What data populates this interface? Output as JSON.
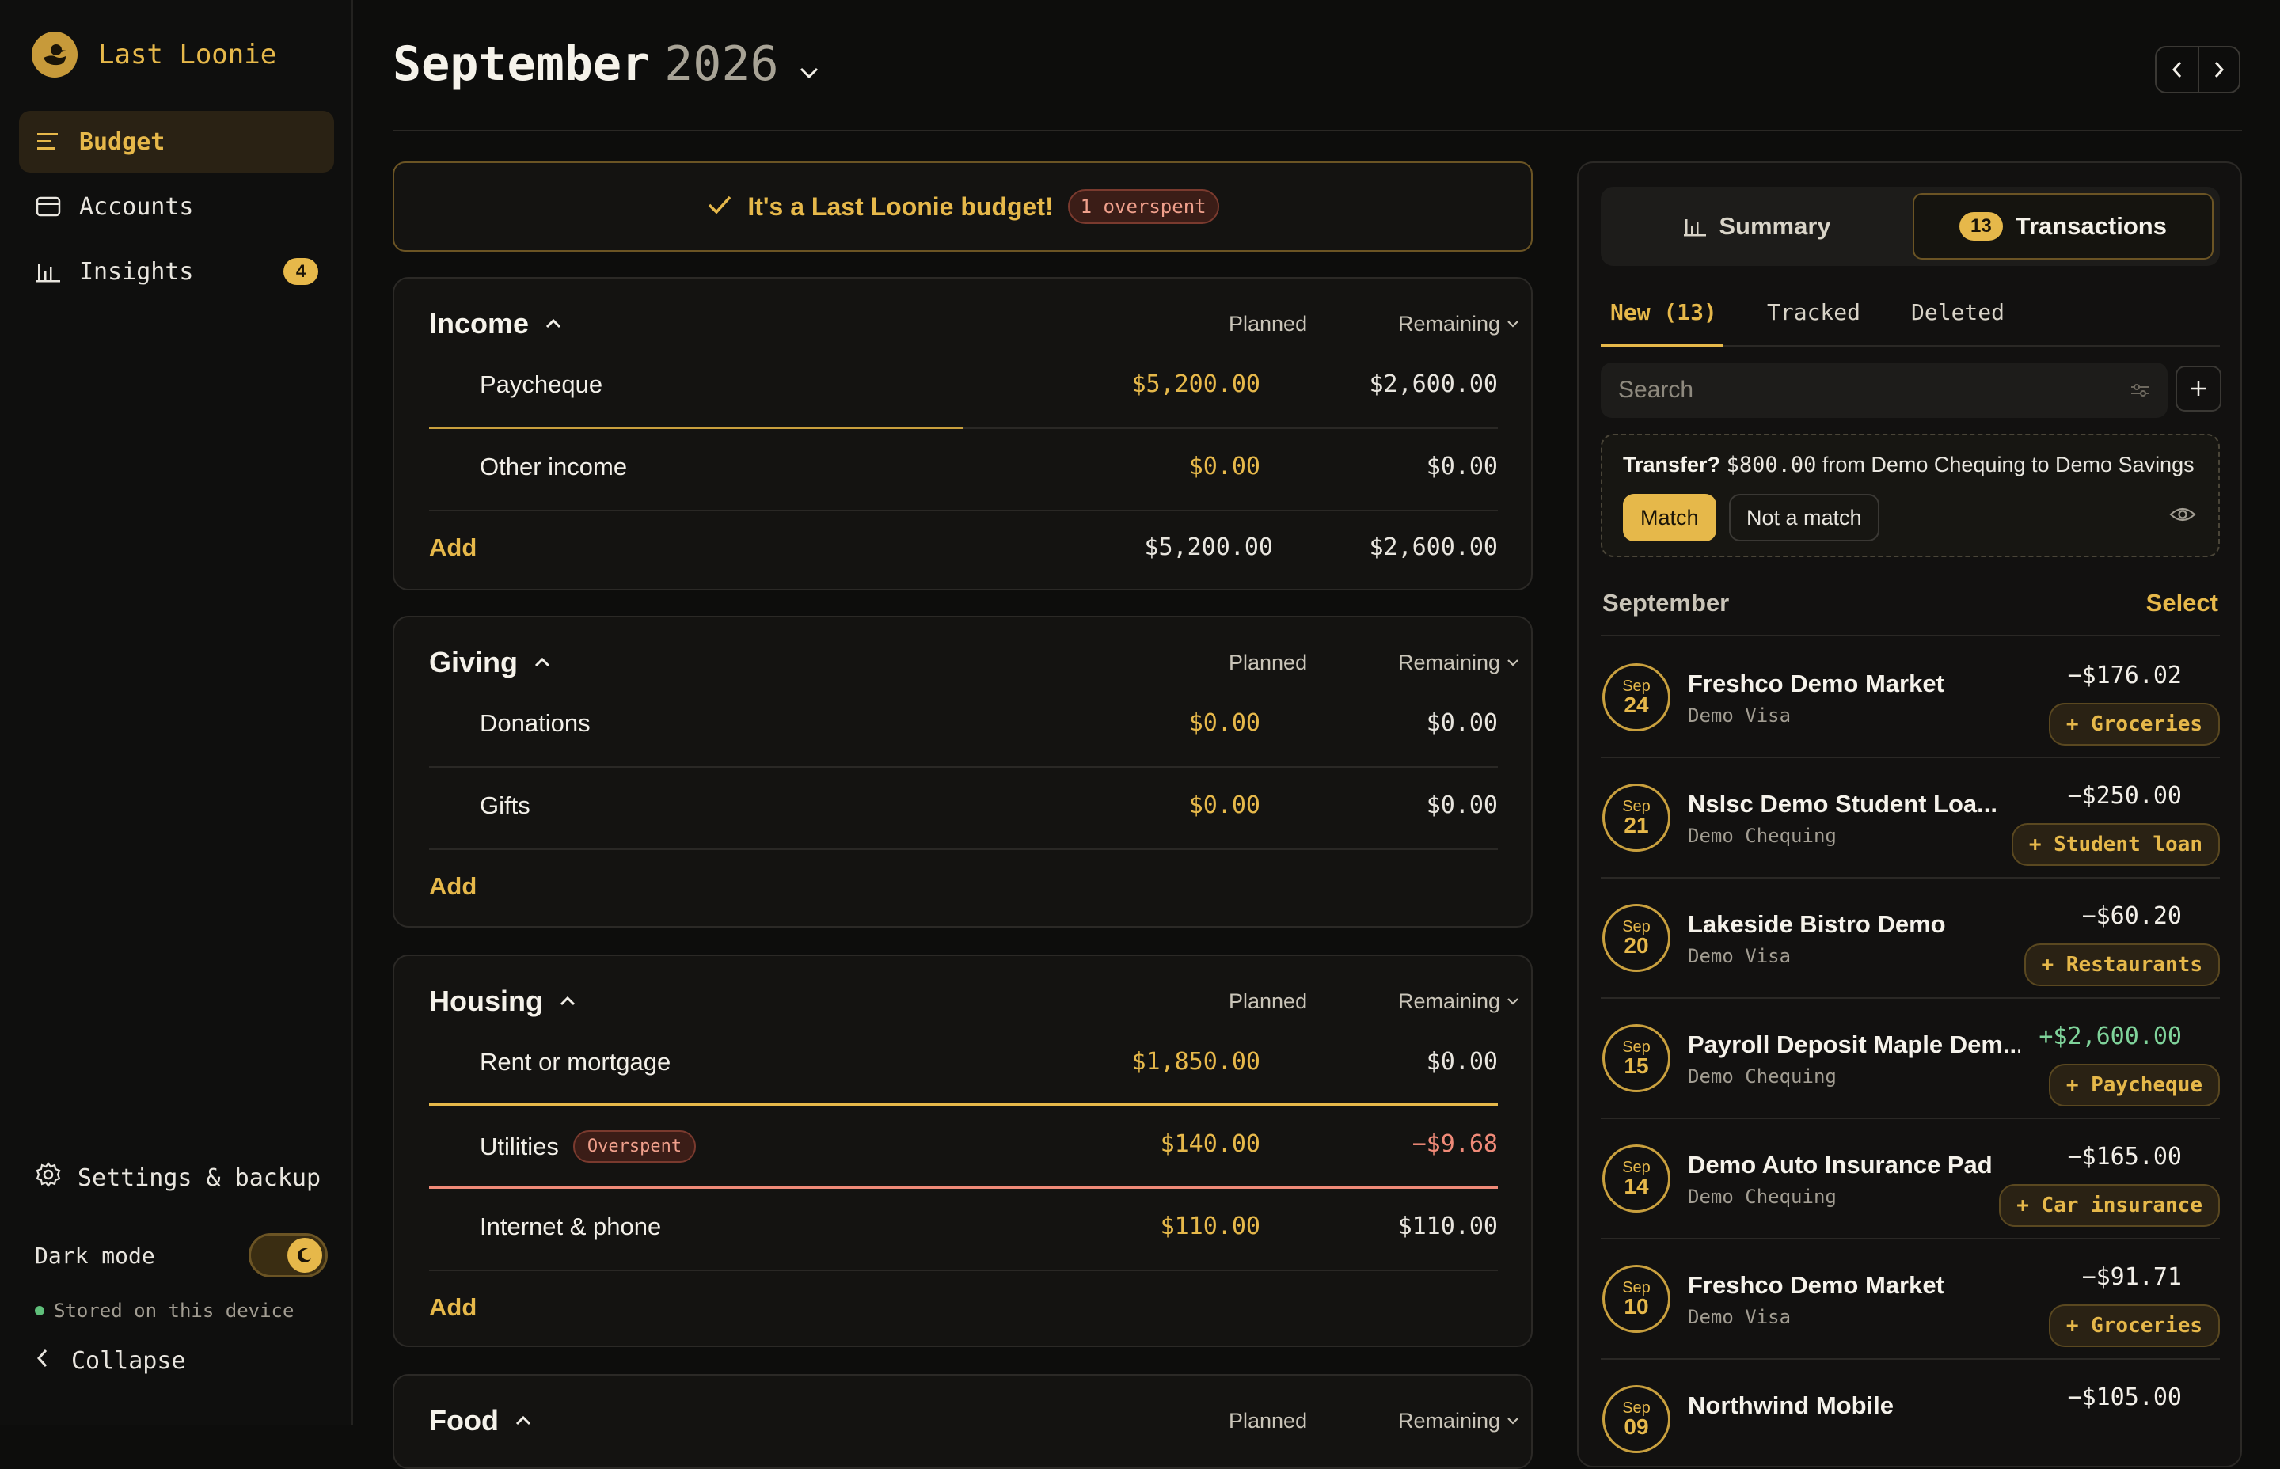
{
  "app": {
    "name": "Last Loonie"
  },
  "sidebar": {
    "items": [
      {
        "label": "Budget",
        "active": true
      },
      {
        "label": "Accounts"
      },
      {
        "label": "Insights",
        "badge": "4"
      }
    ],
    "settings_label": "Settings & backup",
    "dark_mode_label": "Dark mode",
    "stored_label": "Stored on this device",
    "collapse_label": "Collapse"
  },
  "header": {
    "month": "September",
    "year": "2026"
  },
  "banner": {
    "text": "It's a Last Loonie budget!",
    "badge": "1 overspent"
  },
  "budget": {
    "col_planned": "Planned",
    "col_remaining": "Remaining",
    "add_label": "Add",
    "groups": [
      {
        "title": "Income",
        "rows": [
          {
            "name": "Paycheque",
            "planned": "$5,200.00",
            "remaining": "$2,600.00",
            "progress": 0.5
          },
          {
            "name": "Other income",
            "planned": "$0.00",
            "remaining": "$0.00",
            "progress": 0
          }
        ],
        "total_planned": "$5,200.00",
        "total_remaining": "$2,600.00"
      },
      {
        "title": "Giving",
        "rows": [
          {
            "name": "Donations",
            "planned": "$0.00",
            "remaining": "$0.00",
            "progress": 0
          },
          {
            "name": "Gifts",
            "planned": "$0.00",
            "remaining": "$0.00",
            "progress": 0
          }
        ]
      },
      {
        "title": "Housing",
        "rows": [
          {
            "name": "Rent or mortgage",
            "planned": "$1,850.00",
            "remaining": "$0.00",
            "progress": 1
          },
          {
            "name": "Utilities",
            "tag": "Overspent",
            "planned": "$140.00",
            "remaining": "−$9.68",
            "progress": 1
          },
          {
            "name": "Internet & phone",
            "planned": "$110.00",
            "remaining": "$110.00",
            "progress": 0
          }
        ]
      },
      {
        "title": "Food"
      }
    ]
  },
  "panel": {
    "seg_summary": "Summary",
    "seg_transactions": "Transactions",
    "seg_count": "13",
    "tabs": [
      "New (13)",
      "Tracked",
      "Deleted"
    ],
    "search_placeholder": "Search",
    "transfer": {
      "prefix": "Transfer?",
      "amount": "$800.00",
      "text": "from Demo Chequing to Demo Savings",
      "match": "Match",
      "not_match": "Not a match"
    },
    "month_label": "September",
    "select_label": "Select",
    "transactions": [
      {
        "mo": "Sep",
        "day": "24",
        "payee": "Freshco Demo Market",
        "account": "Demo Visa",
        "amount": "−$176.02",
        "category": "+ Groceries"
      },
      {
        "mo": "Sep",
        "day": "21",
        "payee": "Nslsc Demo Student Loa...",
        "account": "Demo Chequing",
        "amount": "−$250.00",
        "category": "+ Student loan"
      },
      {
        "mo": "Sep",
        "day": "20",
        "payee": "Lakeside Bistro Demo",
        "account": "Demo Visa",
        "amount": "−$60.20",
        "category": "+ Restaurants"
      },
      {
        "mo": "Sep",
        "day": "15",
        "payee": "Payroll Deposit Maple Dem...",
        "account": "Demo Chequing",
        "amount": "+$2,600.00",
        "category": "+ Paycheque"
      },
      {
        "mo": "Sep",
        "day": "14",
        "payee": "Demo Auto Insurance Pad",
        "account": "Demo Chequing",
        "amount": "−$165.00",
        "category": "+ Car insurance"
      },
      {
        "mo": "Sep",
        "day": "10",
        "payee": "Freshco Demo Market",
        "account": "Demo Visa",
        "amount": "−$91.71",
        "category": "+ Groceries"
      },
      {
        "mo": "Sep",
        "day": "09",
        "payee": "Northwind Mobile",
        "account": "",
        "amount": "−$105.00",
        "category": ""
      }
    ]
  },
  "colors": {
    "accent": "#e6b84a",
    "negative": "#f08a78",
    "positive": "#7fd39a",
    "background": "#0d0d0c"
  },
  "icons": [
    "duck-logo-icon",
    "budget-list-icon",
    "card-icon",
    "bar-chart-icon",
    "gear-icon",
    "moon-icon",
    "chevron-left-icon",
    "chevron-right-icon",
    "chevron-down-icon",
    "chevron-up-icon",
    "check-icon",
    "filter-icon",
    "plus-icon",
    "eye-icon"
  ]
}
